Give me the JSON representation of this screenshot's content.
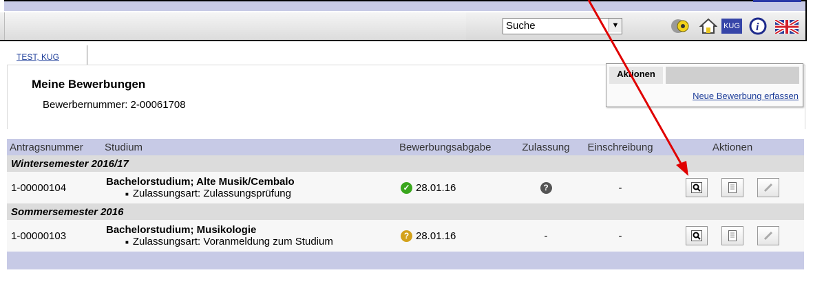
{
  "header": {
    "search_value": "Suche",
    "icons": [
      "key-icon",
      "home-icon",
      "kug-icon",
      "info-icon",
      "uk-flag-icon"
    ],
    "kug_label": "KUG"
  },
  "tab": {
    "label": "TEST, KUG"
  },
  "page": {
    "title": "Meine Bewerbungen",
    "applicant_number": "Bewerbernummer: 2-00061708"
  },
  "actions_box": {
    "label": "Aktionen",
    "link": "Neue Bewerbung erfassen"
  },
  "table": {
    "columns": [
      "Antragsnummer",
      "Studium",
      "Bewerbungsabgabe",
      "Zulassung",
      "Einschreibung",
      "Aktionen"
    ],
    "groups": [
      {
        "semester": "Wintersemester 2016/17",
        "rows": [
          {
            "number": "1-00000104",
            "study": "Bachelorstudium; Alte Musik/Cembalo",
            "detail": "Zulassungsart: Zulassungsprüfung",
            "submitted": "28.01.16",
            "submitted_status": "ok",
            "admission": "?",
            "enrollment": "-"
          }
        ]
      },
      {
        "semester": "Sommersemester 2016",
        "rows": [
          {
            "number": "1-00000103",
            "study": "Bachelorstudium; Musikologie",
            "detail": "Zulassungsart: Voranmeldung zum Studium",
            "submitted": "28.01.16",
            "submitted_status": "pending",
            "admission": "-",
            "enrollment": "-"
          }
        ]
      }
    ]
  },
  "colors": {
    "accent": "#c7cae6",
    "link": "#1f3f9a",
    "annotation_arrow": "#e00000"
  }
}
